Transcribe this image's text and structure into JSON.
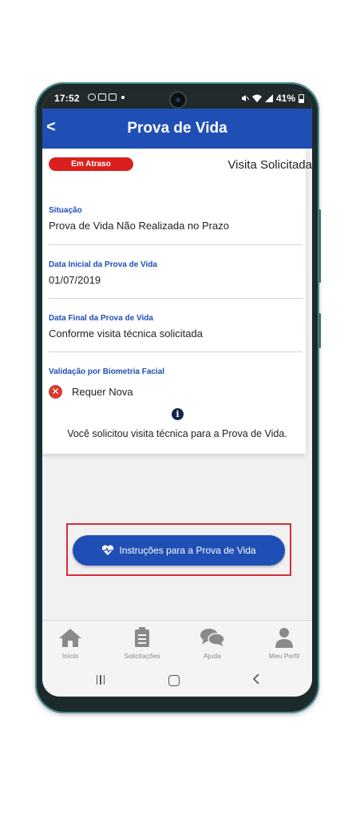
{
  "status_bar": {
    "time": "17:52",
    "battery": "41%",
    "icons": [
      "whatsapp-icon",
      "image-icon",
      "message-icon",
      "mute-icon",
      "wifi-icon",
      "signal-icon",
      "battery-icon"
    ]
  },
  "header": {
    "title": "Prova de Vida",
    "back_label": "<"
  },
  "card": {
    "badge": "Em Atraso",
    "visit_status": "Visita Solicitada",
    "fields": [
      {
        "label": "Situação",
        "value": "Prova de Vida Não Realizada no Prazo"
      },
      {
        "label": "Data Inicial da Prova de Vida",
        "value": "01/07/2019"
      },
      {
        "label": "Data Final da Prova de Vida",
        "value": "Conforme visita técnica solicitada"
      },
      {
        "label": "Validação por Biometria Facial",
        "value": "Requer Nova"
      }
    ],
    "info_message": "Você solicitou visita técnica para a Prova de Vida."
  },
  "cta": {
    "label": "Instruções para a Prova de Vida"
  },
  "bottom_nav": [
    {
      "label": "Início",
      "icon": "home-icon"
    },
    {
      "label": "Solicitações",
      "icon": "clipboard-icon"
    },
    {
      "label": "Ajuda",
      "icon": "chat-icon"
    },
    {
      "label": "Meu Perfil",
      "icon": "user-icon"
    }
  ],
  "colors": {
    "primary": "#1f4fb4",
    "badge_red": "#d9201f",
    "highlight_border": "#d32d36",
    "error_icon": "#d63a36",
    "label_blue": "#1f4fb4"
  }
}
